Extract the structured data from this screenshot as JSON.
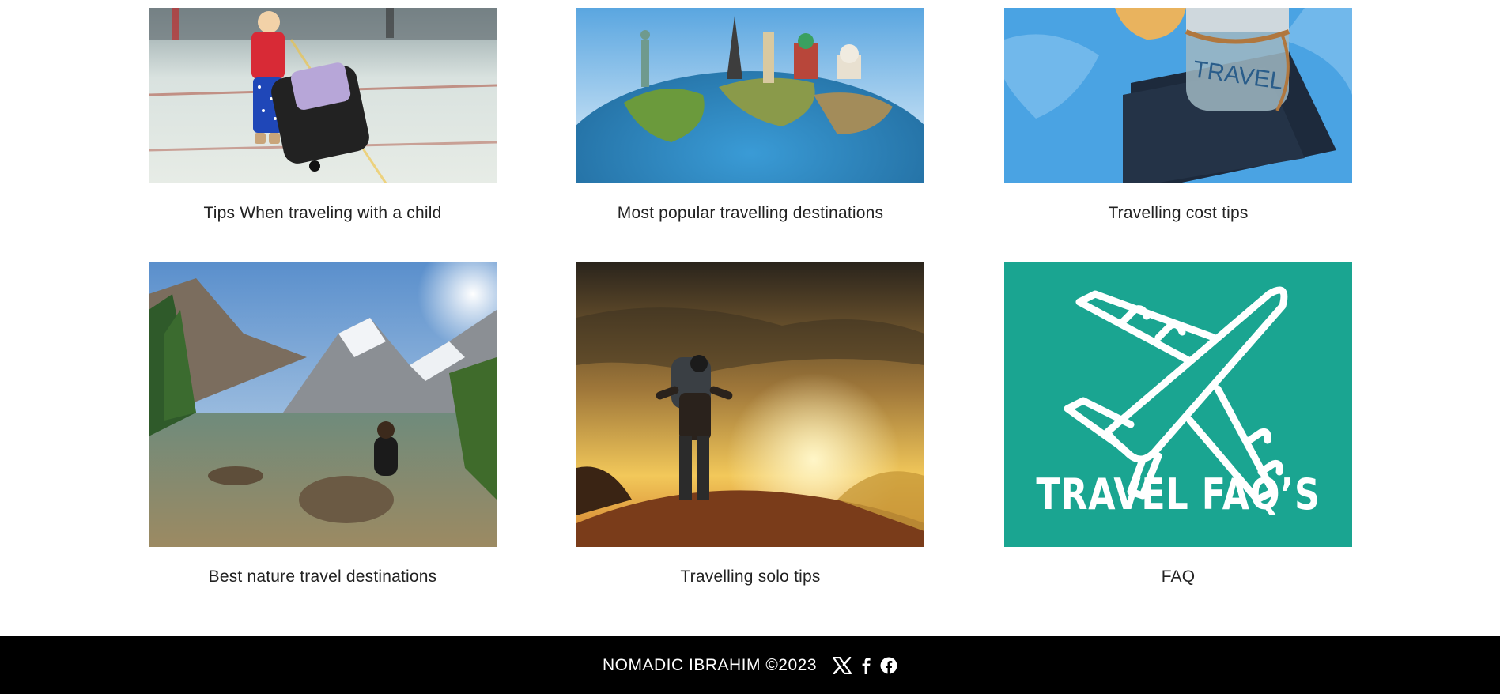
{
  "cards": [
    {
      "caption": "Tips When traveling with a child",
      "image": "child-with-luggage-photo"
    },
    {
      "caption": "Most popular travelling destinations",
      "image": "world-landmarks-globe-photo"
    },
    {
      "caption": "Travelling cost tips",
      "image": "travel-jar-passport-map-photo"
    },
    {
      "caption": "Best nature travel destinations",
      "image": "mountain-lake-photo"
    },
    {
      "caption": "Travelling solo tips",
      "image": "backpacker-sunset-photo"
    },
    {
      "caption": "FAQ",
      "image": "travel-faq-airplane-graphic",
      "graphic_text": "TRAVEL FAQ’S"
    }
  ],
  "footer": {
    "copyright": "NOMADIC IBRAHIM ©2023",
    "icons": [
      "x-twitter-icon",
      "facebook-f-icon",
      "facebook-circle-icon"
    ]
  },
  "colors": {
    "footer_bg": "#000000",
    "faq_bg": "#1aa591",
    "text": "#222222"
  }
}
